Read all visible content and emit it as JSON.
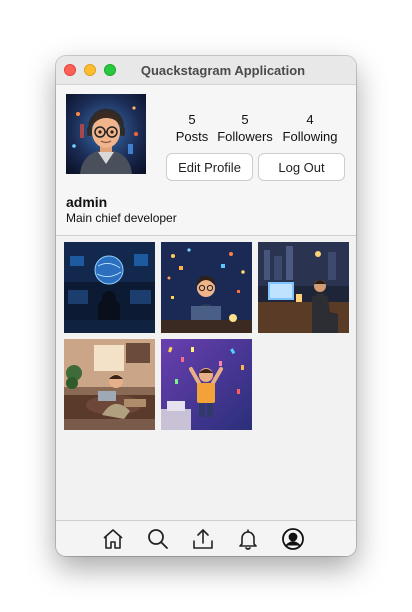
{
  "window": {
    "title": "Quackstagram Application"
  },
  "profile": {
    "username": "admin",
    "bio": "Main chief developer",
    "stats": [
      {
        "value": "5",
        "label": "Posts"
      },
      {
        "value": "5",
        "label": "Followers"
      },
      {
        "value": "4",
        "label": "Following"
      }
    ],
    "edit_profile_label": "Edit Profile",
    "logout_label": "Log Out"
  },
  "posts": [
    {
      "name": "post-1",
      "scene": "developer with globe hologram"
    },
    {
      "name": "post-2",
      "scene": "developer surrounded by icons"
    },
    {
      "name": "post-3",
      "scene": "developer at night city desk"
    },
    {
      "name": "post-4",
      "scene": "developer with laptop in room"
    },
    {
      "name": "post-5",
      "scene": "developer celebrating with confetti"
    }
  ],
  "nav": {
    "icons": [
      "home-icon",
      "search-icon",
      "upload-icon",
      "notifications-icon",
      "profile-icon"
    ]
  }
}
